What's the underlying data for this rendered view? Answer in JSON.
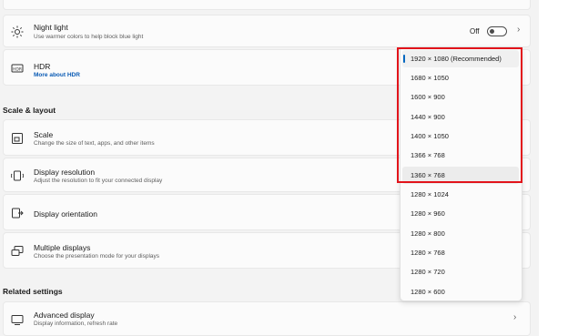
{
  "night_light": {
    "title": "Night light",
    "subtitle": "Use warmer colors to help block blue light",
    "toggle_state": "Off",
    "icon": "sun-icon"
  },
  "hdr": {
    "title": "HDR",
    "link": "More about HDR",
    "icon": "hdr-icon"
  },
  "scale_layout": {
    "heading": "Scale & layout",
    "scale": {
      "title": "Scale",
      "subtitle": "Change the size of text, apps, and other items",
      "icon": "scale-icon"
    },
    "display_resolution": {
      "title": "Display resolution",
      "subtitle": "Adjust the resolution to fit your connected display",
      "icon": "resolution-icon"
    },
    "display_orientation": {
      "title": "Display orientation",
      "icon": "orientation-icon"
    },
    "multiple_displays": {
      "title": "Multiple displays",
      "subtitle": "Choose the presentation mode for your displays",
      "icon": "multiple-displays-icon"
    }
  },
  "related": {
    "heading": "Related settings",
    "advanced_display": {
      "title": "Advanced display",
      "subtitle": "Display information, refresh rate",
      "icon": "monitor-icon"
    }
  },
  "resolution_options": [
    "1920 × 1080 (Recommended)",
    "1680 × 1050",
    "1600 × 900",
    "1440 × 900",
    "1400 × 1050",
    "1366 × 768",
    "1360 × 768",
    "1280 × 1024",
    "1280 × 960",
    "1280 × 800",
    "1280 × 768",
    "1280 × 720",
    "1280 × 600"
  ],
  "selected_option": "1920 × 1080 (Recommended)",
  "hovered_option": "1360 × 768",
  "colors": {
    "accent": "#0067c0",
    "highlight": "#e2141b",
    "link": "#0a5bb5"
  }
}
